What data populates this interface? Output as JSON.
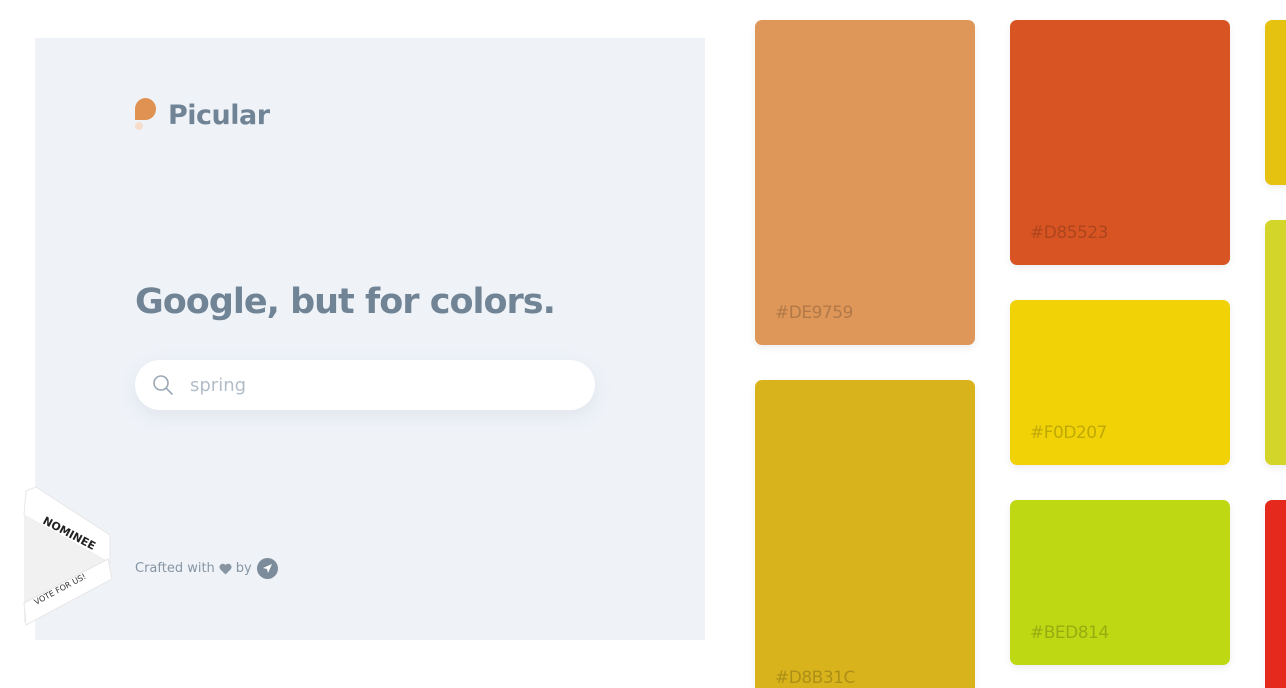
{
  "brand": {
    "name": "Picular"
  },
  "headline": "Google, but for colors.",
  "search": {
    "value": "spring",
    "placeholder": ""
  },
  "footer": {
    "crafted_text": "Crafted with",
    "by_text": "by"
  },
  "ribbon": {
    "top_text": "NOMINEE",
    "bottom_text": "VOTE FOR US!"
  },
  "colors": {
    "panel_bg": "#EFF3F8",
    "text": "#708496",
    "logo_accent": "#E09252"
  },
  "swatches": [
    {
      "hex": "#DE9759",
      "label": "#DE9759"
    },
    {
      "hex": "#D8B31C",
      "label": "#D8B31C"
    },
    {
      "hex": "#D85523",
      "label": "#D85523"
    },
    {
      "hex": "#F0D207",
      "label": "#F0D207"
    },
    {
      "hex": "#BED814",
      "label": "#BED814"
    },
    {
      "hex": "#E5C210",
      "label": ""
    },
    {
      "hex": "#D4D52A",
      "label": ""
    },
    {
      "hex": "#E5291C",
      "label": ""
    }
  ],
  "icons": [
    "search-icon",
    "heart-icon",
    "rocket-icon"
  ]
}
